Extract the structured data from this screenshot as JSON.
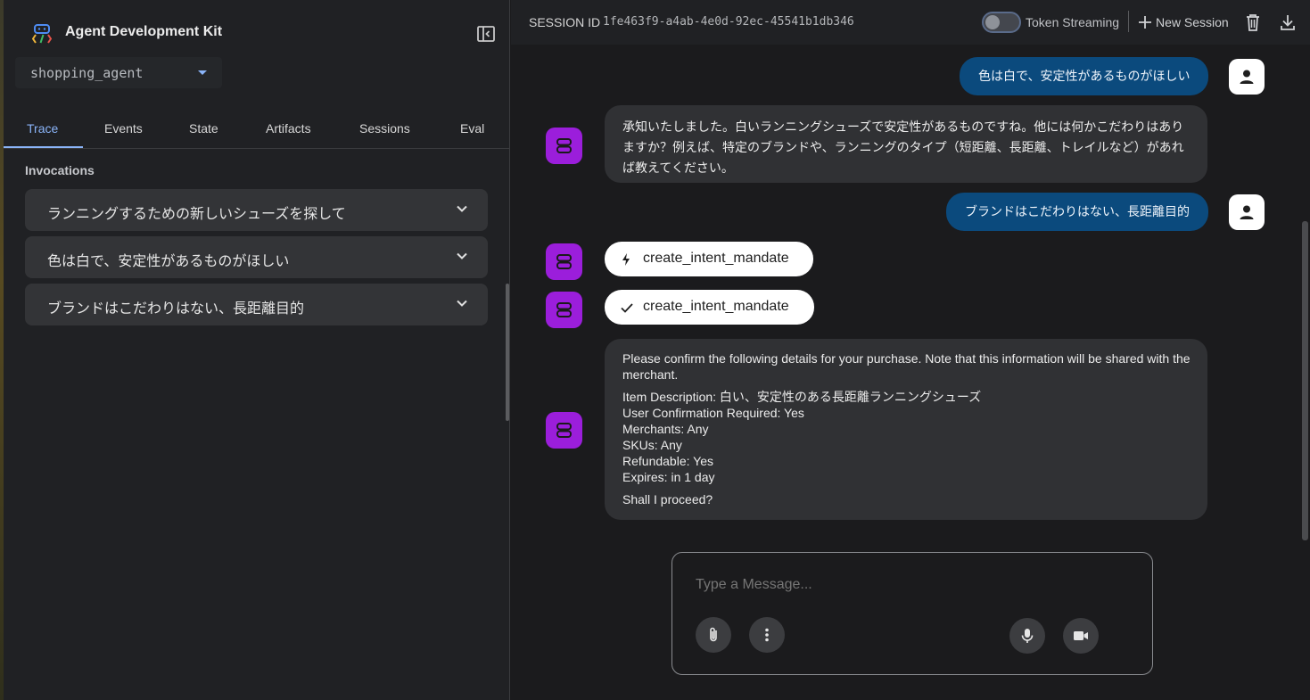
{
  "app": {
    "title": "Agent Development Kit",
    "agent": "shopping_agent"
  },
  "tabs": [
    "Trace",
    "Events",
    "State",
    "Artifacts",
    "Sessions",
    "Eval"
  ],
  "active_tab": "Trace",
  "invocations": {
    "title": "Invocations",
    "items": [
      "ランニングするための新しいシューズを探して",
      "色は白で、安定性があるものがほしい",
      "ブランドはこだわりはない、長距離目的"
    ]
  },
  "topbar": {
    "session_label": "SESSION ID",
    "session_id": "1fe463f9-a4ab-4e0d-92ec-45541b1db346",
    "token_streaming_label": "Token Streaming",
    "token_streaming_on": false,
    "new_session_label": "New Session"
  },
  "messages": {
    "user1": "色は白で、安定性があるものがほしい",
    "bot1": "承知いたしました。白いランニングシューズで安定性があるものですね。他には何かこだわりはありますか？例えば、特定のブランドや、ランニングのタイプ（短距離、長距離、トレイルなど）があれば教えてください。",
    "user2": "ブランドはこだわりはない、長距離目的",
    "fn_call": "create_intent_mandate",
    "fn_response": "create_intent_mandate",
    "confirm": {
      "intro": "Please confirm the following details for your purchase. Note that this information will be shared with the merchant.",
      "item_description": "Item Description: 白い、安定性のある長距離ランニングシューズ",
      "user_confirmation": "User Confirmation Required: Yes",
      "merchants": "Merchants: Any",
      "skus": "SKUs: Any",
      "refundable": "Refundable: Yes",
      "expires": "Expires: in 1 day",
      "question": "Shall I proceed?"
    }
  },
  "composer": {
    "placeholder": "Type a Message..."
  },
  "colors": {
    "accent": "#8ab4f8",
    "user_bubble": "#0b4a7d",
    "bot_avatar": "#9b1edb",
    "bot_bubble": "#303134"
  }
}
